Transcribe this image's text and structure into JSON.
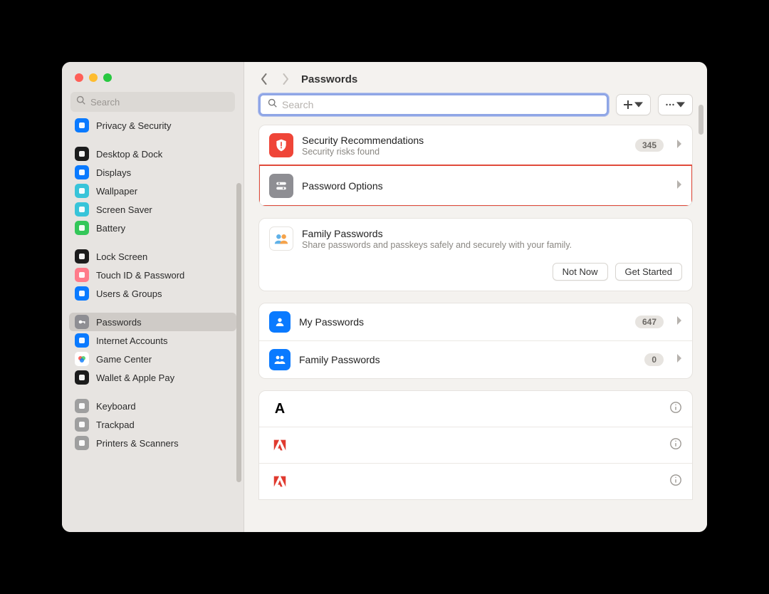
{
  "window": {
    "title": "Passwords"
  },
  "colors": {
    "accent": "#0a7aff",
    "highlight": "#e04a3a"
  },
  "sidebar": {
    "search_placeholder": "Search",
    "items": [
      {
        "label": "Privacy & Security",
        "icon": "hand-icon",
        "color": "#0a7aff"
      },
      {
        "spacer": true
      },
      {
        "label": "Desktop & Dock",
        "icon": "dock-icon",
        "color": "#1c1c1c"
      },
      {
        "label": "Displays",
        "icon": "sun-icon",
        "color": "#0a7aff"
      },
      {
        "label": "Wallpaper",
        "icon": "flower-icon",
        "color": "#38c4d9"
      },
      {
        "label": "Screen Saver",
        "icon": "screensaver-icon",
        "color": "#38c4d9"
      },
      {
        "label": "Battery",
        "icon": "battery-icon",
        "color": "#34c759"
      },
      {
        "spacer": true
      },
      {
        "label": "Lock Screen",
        "icon": "lock-icon",
        "color": "#1c1c1c"
      },
      {
        "label": "Touch ID & Password",
        "icon": "fingerprint-icon",
        "color": "#ff7b8a"
      },
      {
        "label": "Users & Groups",
        "icon": "users-icon",
        "color": "#0a7aff"
      },
      {
        "spacer": true
      },
      {
        "label": "Passwords",
        "icon": "key-icon",
        "color": "#8e8e93",
        "selected": true
      },
      {
        "label": "Internet Accounts",
        "icon": "at-icon",
        "color": "#0a7aff"
      },
      {
        "label": "Game Center",
        "icon": "gamecenter-icon",
        "color": "#ffffff"
      },
      {
        "label": "Wallet & Apple Pay",
        "icon": "wallet-icon",
        "color": "#1c1c1c"
      },
      {
        "spacer": true
      },
      {
        "label": "Keyboard",
        "icon": "keyboard-icon",
        "color": "#9f9f9f"
      },
      {
        "label": "Trackpad",
        "icon": "trackpad-icon",
        "color": "#9f9f9f"
      },
      {
        "label": "Printers & Scanners",
        "icon": "printer-icon",
        "color": "#9f9f9f"
      }
    ]
  },
  "main": {
    "search_placeholder": "Search",
    "security_recs": {
      "title": "Security Recommendations",
      "subtitle": "Security risks found",
      "count": "345"
    },
    "password_options": {
      "title": "Password Options"
    },
    "family": {
      "title": "Family Passwords",
      "subtitle": "Share passwords and passkeys safely and securely with your family.",
      "not_now": "Not Now",
      "get_started": "Get Started"
    },
    "groups": [
      {
        "label": "My Passwords",
        "count": "647",
        "icon": "person-icon"
      },
      {
        "label": "Family Passwords",
        "count": "0",
        "icon": "people-icon"
      }
    ],
    "entries": [
      {
        "glyph": "A",
        "color": "#000000"
      },
      {
        "glyph": "A",
        "color": "#e03a2f",
        "adobe": true
      },
      {
        "glyph": "A",
        "color": "#e03a2f",
        "adobe": true
      }
    ]
  }
}
